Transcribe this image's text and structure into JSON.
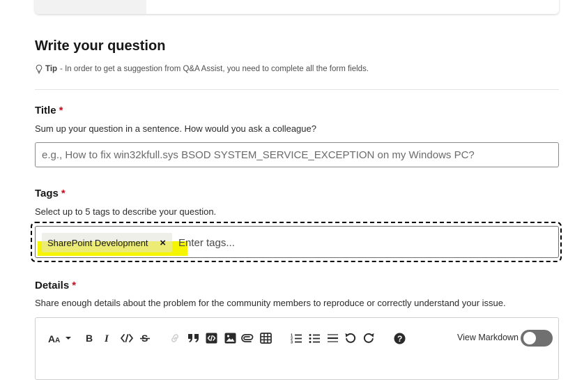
{
  "header": {
    "title": "Write your question",
    "tip_label": "Tip",
    "tip_text": "- In order to get a suggestion from Q&A Assist, you need to complete all the form fields."
  },
  "title_field": {
    "label": "Title",
    "required_mark": "*",
    "hint": "Sum up your question in a sentence. How would you ask a colleague?",
    "value": "",
    "placeholder": "e.g., How to fix win32kfull.sys BSOD SYSTEM_SERVICE_EXCEPTION on my Windows PC?"
  },
  "tags_field": {
    "label": "Tags",
    "required_mark": "*",
    "hint": "Select up to 5 tags to describe your question.",
    "selected_tags": [
      {
        "label": "SharePoint Development",
        "remove": "×"
      }
    ],
    "placeholder": "Enter tags...",
    "highlight_color": "#f5f500"
  },
  "details_field": {
    "label": "Details",
    "required_mark": "*",
    "hint": "Share enough details about the problem for the community members to reproduce or correctly understand your issue."
  },
  "editor_toolbar": {
    "buttons": [
      {
        "name": "text-size",
        "icon": "text-size-icon",
        "glyph": "AA"
      },
      {
        "name": "text-size-dropdown",
        "icon": "caret-down-icon",
        "glyph": "▾"
      },
      {
        "name": "bold",
        "icon": "bold-icon",
        "glyph": "B"
      },
      {
        "name": "italic",
        "icon": "italic-icon",
        "glyph": "I"
      },
      {
        "name": "code",
        "icon": "code-icon",
        "glyph": "</>"
      },
      {
        "name": "strikethrough",
        "icon": "strikethrough-icon",
        "glyph": "S"
      },
      {
        "name": "link",
        "icon": "link-icon",
        "glyph": "link",
        "disabled": true
      },
      {
        "name": "quote",
        "icon": "quote-icon",
        "glyph": "❞"
      },
      {
        "name": "code-block",
        "icon": "code-block-icon",
        "glyph": "code"
      },
      {
        "name": "image",
        "icon": "image-icon",
        "glyph": "img"
      },
      {
        "name": "attachment",
        "icon": "paperclip-icon",
        "glyph": "clip"
      },
      {
        "name": "table",
        "icon": "table-icon",
        "glyph": "table"
      },
      {
        "name": "numbered-list",
        "icon": "numbered-list-icon",
        "glyph": "ol"
      },
      {
        "name": "bulleted-list",
        "icon": "bulleted-list-icon",
        "glyph": "ul"
      },
      {
        "name": "horizontal-rule",
        "icon": "horizontal-rule-icon",
        "glyph": "hr"
      },
      {
        "name": "undo",
        "icon": "undo-icon",
        "glyph": "↺"
      },
      {
        "name": "redo",
        "icon": "redo-icon",
        "glyph": "↻"
      },
      {
        "name": "help",
        "icon": "help-icon",
        "glyph": "?"
      }
    ],
    "view_markdown_label": "View Markdown",
    "view_markdown_on": false
  }
}
